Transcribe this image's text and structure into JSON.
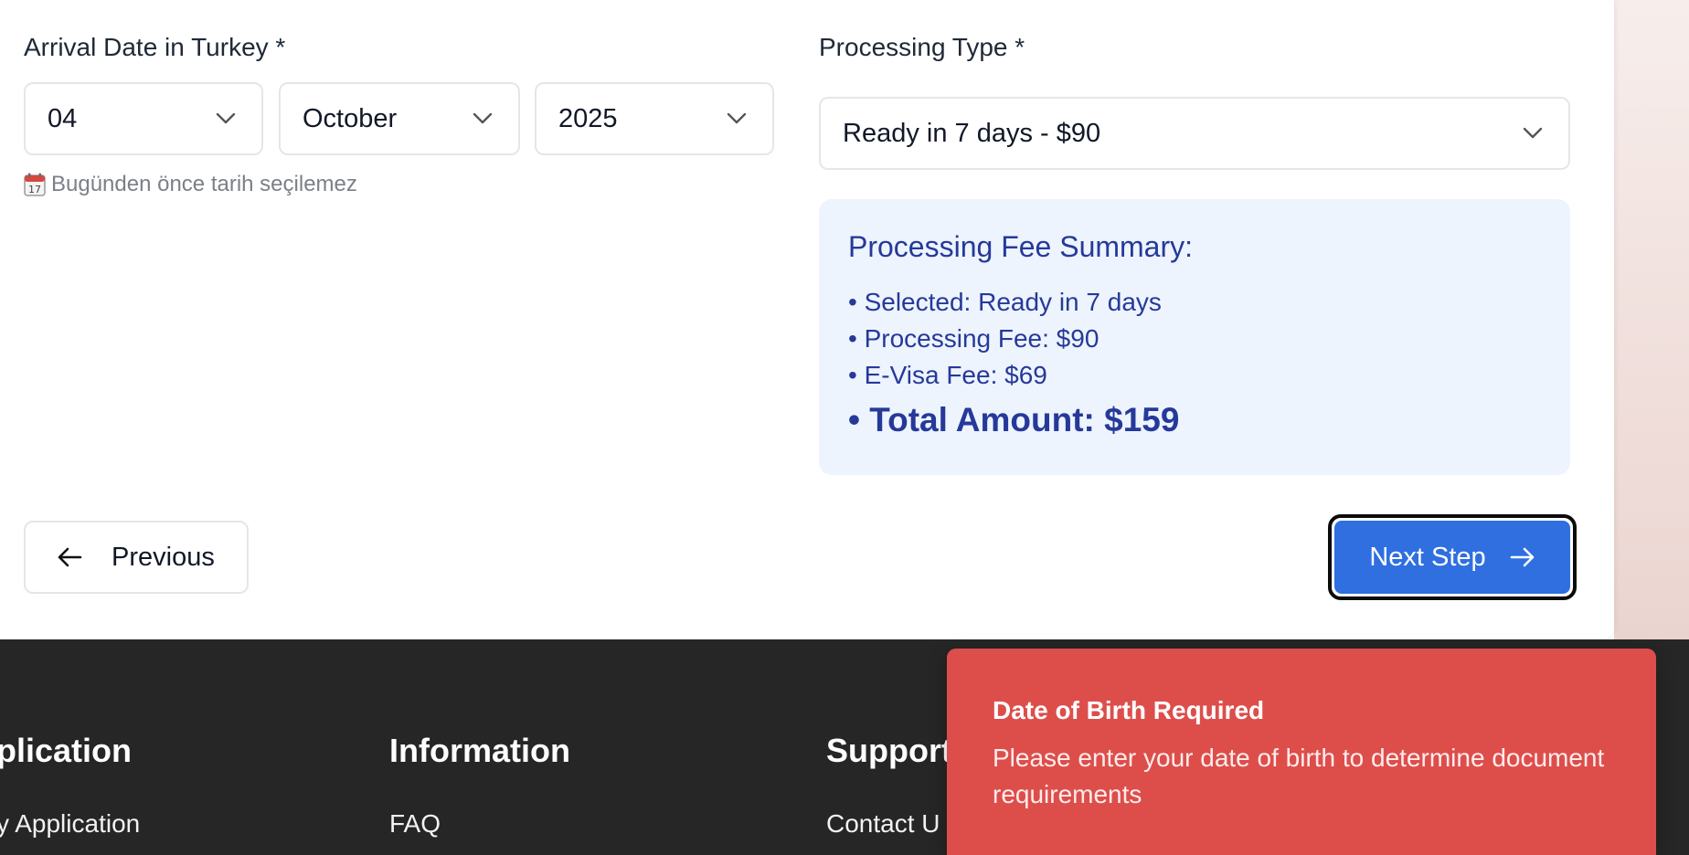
{
  "form": {
    "arrival_label": "Arrival Date in Turkey *",
    "day": {
      "value": "04"
    },
    "month": {
      "value": "October"
    },
    "year": {
      "value": "2025"
    },
    "hint": "Bugünden önce tarih seçilemez",
    "processing_label": "Processing Type *",
    "processing": {
      "value": "Ready in 7 days - $90"
    }
  },
  "summary": {
    "title": "Processing Fee Summary:",
    "selected": "• Selected: Ready in 7 days",
    "processing_fee": "• Processing Fee: $90",
    "evisa_fee": "• E-Visa Fee: $69",
    "total": "• Total Amount: $159"
  },
  "nav": {
    "previous_label": "Previous",
    "next_label": "Next Step"
  },
  "footer": {
    "col1_heading": "plication",
    "col1_link": "y Application",
    "col2_heading": "Information",
    "col2_link": "FAQ",
    "col3_heading": "Support",
    "col3_link": "Contact U"
  },
  "toast": {
    "title": "Date of Birth Required",
    "message": "Please enter your date of birth to determine document requirements"
  },
  "colors": {
    "primary": "#2f6fe0",
    "summary_bg": "#edf4fd",
    "summary_text": "#26399a",
    "toast_bg": "#dd4e4b",
    "footer_bg": "#262626"
  },
  "icons": [
    "chevron-down-icon",
    "calendar-icon",
    "arrow-left-icon",
    "arrow-right-icon"
  ]
}
